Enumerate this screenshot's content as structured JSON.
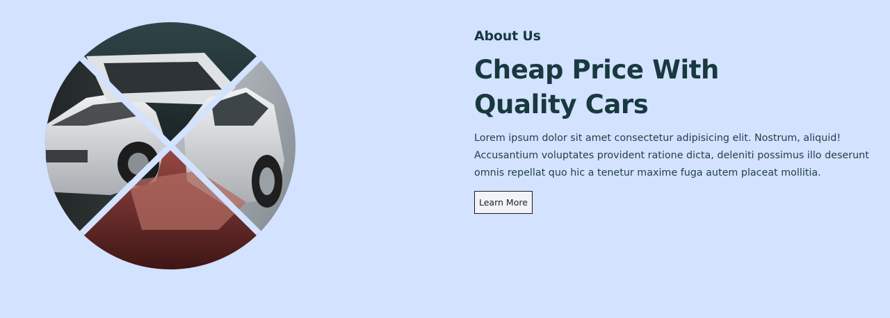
{
  "about": {
    "eyebrow": "About Us",
    "headline_line1": "Cheap Price With",
    "headline_line2": "Quality Cars",
    "description": "Lorem ipsum dolor sit amet consectetur adipisicing elit. Nostrum, aliquid! Accusantium voluptates provident ratione dicta, deleniti possimus illo deserunt omnis repellat quo hic a tenetur maxime fuga autem placeat mollitia.",
    "cta_label": "Learn More"
  },
  "colors": {
    "background": "#d3e2ff",
    "heading": "#17393f",
    "button_border": "#1a1a1a"
  }
}
